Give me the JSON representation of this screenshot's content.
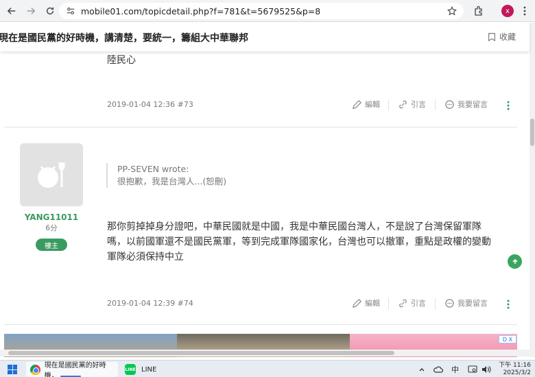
{
  "browser": {
    "url": "mobile01.com/topicdetail.php?f=781&t=5679525&p=8",
    "profile_initial": "x"
  },
  "topic": {
    "title": "現在是國民黨的好時機，講清楚，要統一，籌組大中華聯邦",
    "favorite_label": "收藏"
  },
  "post73": {
    "trailing_text": "陸民心",
    "meta": "2019-01-04 12:36 #73",
    "edit_label": "編輯",
    "quote_label": "引言",
    "reply_label": "我要留言"
  },
  "post74": {
    "username": "YANG11011",
    "score": "6分",
    "badge": "樓主",
    "quote_author": "PP-SEVEN wrote:",
    "quote_text": "很抱歉，我是台灣人...(恕刪)",
    "body_lines": [
      "那你剪掉掉身分證吧，中華民國就是中國，我是中華民國台灣人，不是說了台灣保留軍隊",
      "嗎，以前國軍還不是國民黨軍，等到完成軍隊國家化，台灣也可以撤軍，重點是政權的變動",
      "軍隊必須保持中立"
    ],
    "meta": "2019-01-04 12:39 #74",
    "edit_label": "編輯",
    "quote_label": "引言",
    "reply_label": "我要留言"
  },
  "ad": {
    "badge": "D X"
  },
  "taskbar": {
    "chrome_task": "現在是國民黨的好時機，",
    "line_task": "LINE",
    "line_logo_text": "LINE",
    "ime_label": "中",
    "time": "下午 11:16",
    "date": "2025/3/2"
  },
  "colors": {
    "accent_green": "#3a9b61",
    "badge_green": "#3a9b61"
  }
}
